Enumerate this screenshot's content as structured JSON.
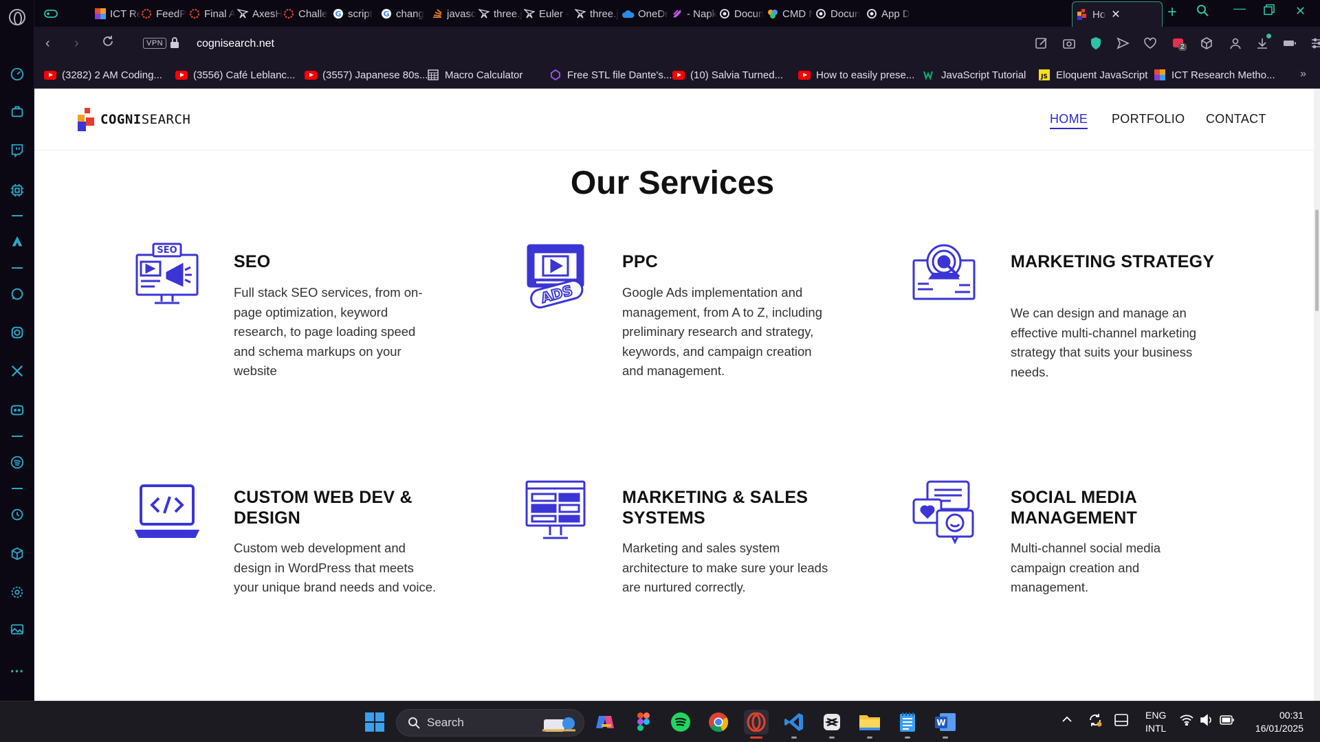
{
  "browser": {
    "tabs": [
      {
        "title": "ICT Re",
        "icon": "gradient-square-icon"
      },
      {
        "title": "FeedP",
        "icon": "dotted-circle-icon"
      },
      {
        "title": "Final A",
        "icon": "dotted-circle-icon"
      },
      {
        "title": "AxesH",
        "icon": "pen-nib-icon"
      },
      {
        "title": "Challe",
        "icon": "dotted-circle-icon"
      },
      {
        "title": "script",
        "icon": "google-icon"
      },
      {
        "title": "chang",
        "icon": "google-icon"
      },
      {
        "title": "javasc",
        "icon": "stack-icon"
      },
      {
        "title": "three.j",
        "icon": "pen-nib-icon"
      },
      {
        "title": "Euler -",
        "icon": "pen-nib-icon"
      },
      {
        "title": "three.j",
        "icon": "pen-nib-icon"
      },
      {
        "title": "OneDr",
        "icon": "cloud-icon"
      },
      {
        "title": "- Napk",
        "icon": "napkin-icon"
      },
      {
        "title": "Docun",
        "icon": "openai-icon"
      },
      {
        "title": "CMD N",
        "icon": "colorful-icon"
      },
      {
        "title": "Docun",
        "icon": "openai-icon"
      },
      {
        "title": "App D",
        "icon": "openai-icon"
      }
    ],
    "active_tab": {
      "title": "Ho",
      "icon": "cognisearch-icon"
    },
    "url": "cognisearch.net",
    "vpn_label": "VPN",
    "extension_badge": "2",
    "bookmarks": [
      {
        "label": "(3282) 2 AM Coding...",
        "icon": "youtube-icon"
      },
      {
        "label": "(3556) Café Leblanc...",
        "icon": "youtube-icon"
      },
      {
        "label": "(3557) Japanese 80s...",
        "icon": "youtube-icon"
      },
      {
        "label": "Macro Calculator",
        "icon": "calculator-icon"
      },
      {
        "label": "Free STL file Dante's...",
        "icon": "cults-icon"
      },
      {
        "label": "(10) Salvia Turned...",
        "icon": "youtube-icon"
      },
      {
        "label": "How to easily prese...",
        "icon": "youtube-icon"
      },
      {
        "label": "JavaScript Tutorial",
        "icon": "w3-icon"
      },
      {
        "label": "Eloquent JavaScript",
        "icon": "js-icon"
      },
      {
        "label": "ICT Research Metho...",
        "icon": "gradient-square-icon"
      }
    ]
  },
  "site": {
    "logo_bold": "COGNI",
    "logo_regular": "SEARCH",
    "nav": {
      "home": "HOME",
      "portfolio": "PORTFOLIO",
      "contact": "CONTACT"
    },
    "section_title": "Our Services",
    "accent": "#3b35d6",
    "services": [
      {
        "title": "SEO",
        "description": "Full stack SEO services, from on-page optimization, keyword research, to page loading speed and schema markups on your website",
        "icon": "seo-monitor-icon",
        "icon_text": "SEO"
      },
      {
        "title": "PPC",
        "description": "Google Ads implementation and management, from A to Z, including preliminary research and strategy, keywords, and campaign creation and management.",
        "icon": "ppc-ads-icon",
        "icon_text": "ADS"
      },
      {
        "title": "MARKETING STRATEGY",
        "description": "We can design and manage an effective multi-channel marketing strategy that suits your business needs.",
        "icon": "target-monitor-icon"
      },
      {
        "title": "CUSTOM WEB DEV & DESIGN",
        "description": "Custom web development and design in WordPress that meets your unique brand needs and voice.",
        "icon": "code-laptop-icon"
      },
      {
        "title": "MARKETING & SALES SYSTEMS",
        "description": "Marketing and sales system architecture to make sure your leads are nurtured correctly.",
        "icon": "dashboard-monitor-icon"
      },
      {
        "title": "SOCIAL MEDIA MANAGEMENT",
        "description": "Multi-channel social media campaign creation and management.",
        "icon": "chat-bubbles-icon"
      }
    ]
  },
  "taskbar": {
    "search_placeholder": "Search",
    "language_line1": "ENG",
    "language_line2": "INTL",
    "time": "00:31",
    "date": "16/01/2025",
    "apps": [
      "start-icon",
      "copilot-icon",
      "figma-icon",
      "spotify-icon",
      "chrome-icon",
      "opera-icon",
      "vscode-icon",
      "capcut-icon",
      "file-explorer-icon",
      "notepad-icon",
      "word-icon"
    ]
  }
}
